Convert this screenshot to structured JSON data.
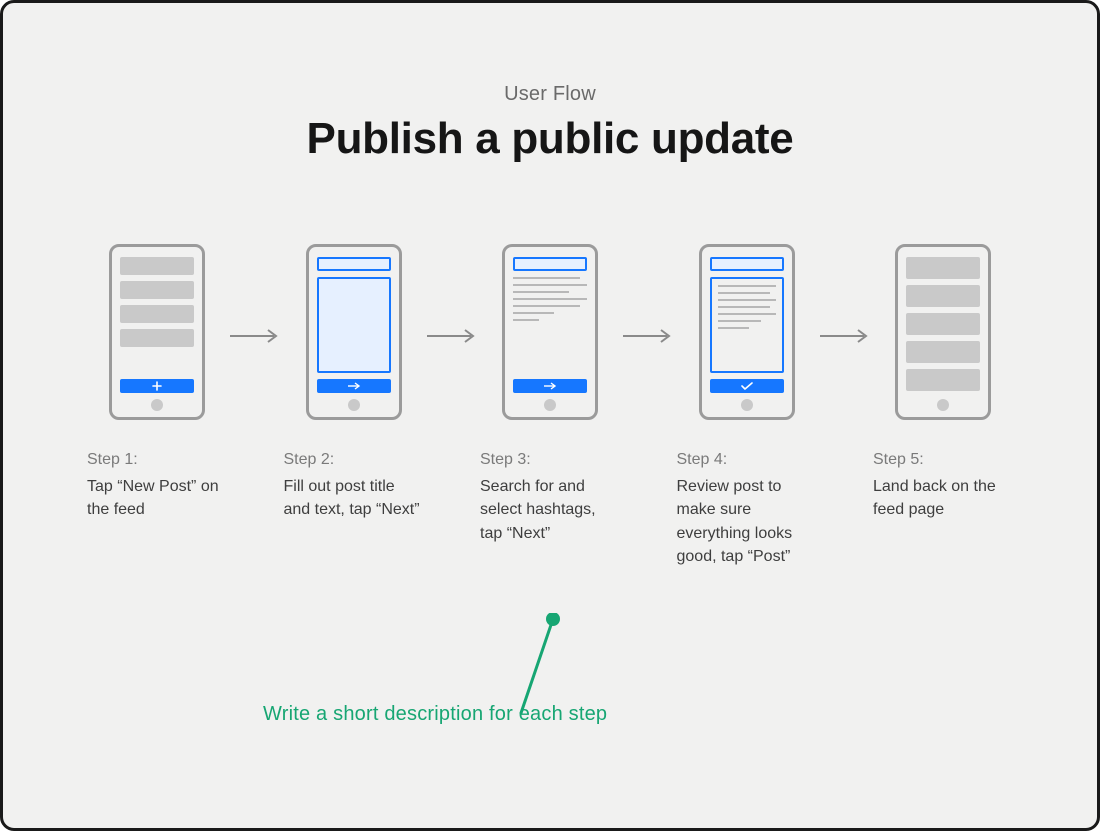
{
  "header": {
    "eyebrow": "User Flow",
    "title": "Publish a public update"
  },
  "steps": [
    {
      "num": "Step 1:",
      "desc": "Tap “New Post” on the feed"
    },
    {
      "num": "Step 2:",
      "desc": "Fill out post title and text, tap “Next”"
    },
    {
      "num": "Step 3:",
      "desc": "Search for and select hashtags, tap “Next”"
    },
    {
      "num": "Step 4:",
      "desc": "Review post to make sure everything looks good, tap “Post”"
    },
    {
      "num": "Step 5:",
      "desc": "Land back on the feed page"
    }
  ],
  "annotation": "Write a short description for each step",
  "colors": {
    "accent_blue": "#1677ff",
    "annotation_green": "#17a673",
    "grey_block": "#c9c9c9",
    "frame_border": "#1a1a1a"
  }
}
